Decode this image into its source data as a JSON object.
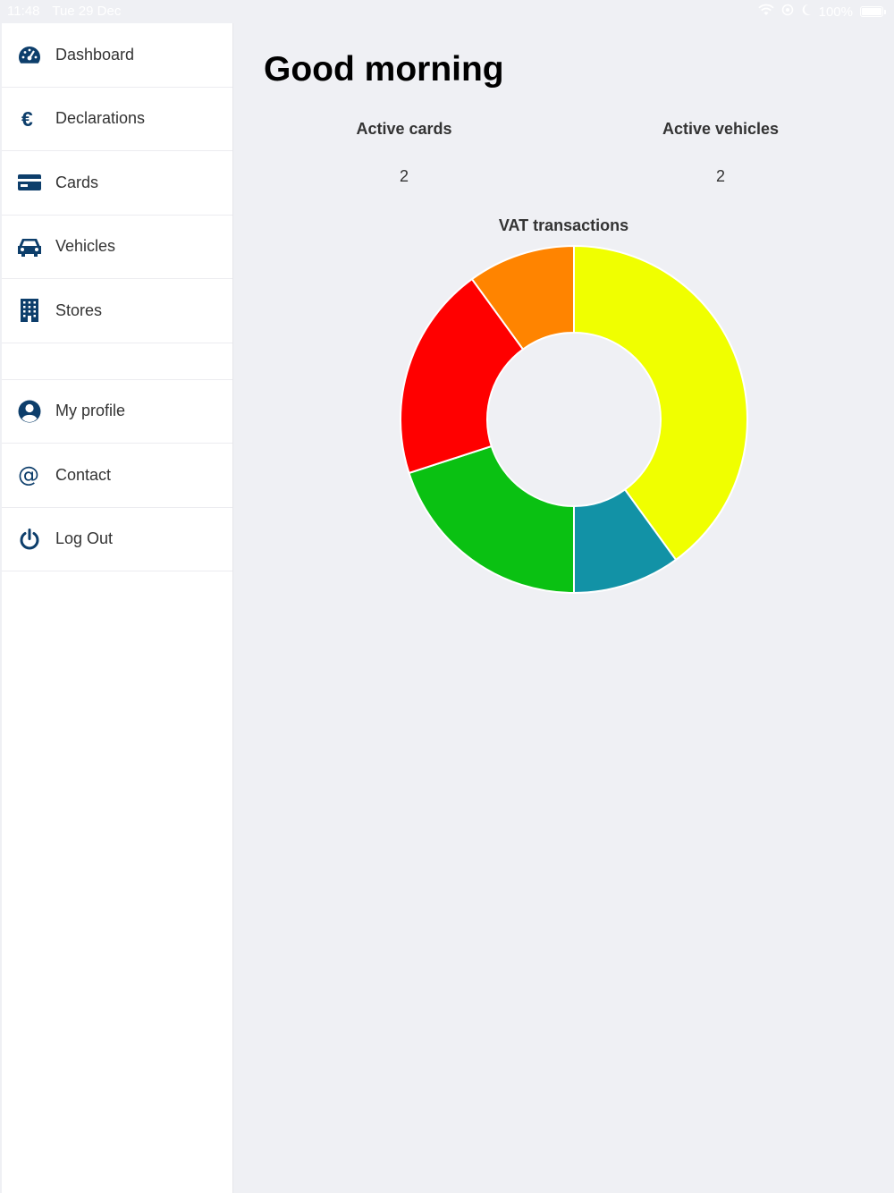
{
  "status_bar": {
    "time": "11:48",
    "date": "Tue 29 Dec",
    "battery": "100%",
    "icons": [
      "wifi-icon",
      "location-lock-icon",
      "moon-icon",
      "battery-icon"
    ]
  },
  "sidebar": {
    "items": [
      {
        "label": "Dashboard",
        "icon": "speedometer-icon"
      },
      {
        "label": "Declarations",
        "icon": "euro-icon"
      },
      {
        "label": "Cards",
        "icon": "credit-card-icon"
      },
      {
        "label": "Vehicles",
        "icon": "car-icon"
      },
      {
        "label": "Stores",
        "icon": "building-icon"
      }
    ],
    "secondary_items": [
      {
        "label": "My profile",
        "icon": "user-icon"
      },
      {
        "label": "Contact",
        "icon": "at-icon"
      },
      {
        "label": "Log Out",
        "icon": "power-icon"
      }
    ],
    "icon_color": "#0d3e6b"
  },
  "main": {
    "greeting": "Good morning",
    "stats": [
      {
        "title": "Active cards",
        "value": "2"
      },
      {
        "title": "Active vehicles",
        "value": "2"
      }
    ]
  },
  "chart_data": {
    "type": "pie",
    "variant": "doughnut",
    "title": "VAT transactions",
    "categories": [
      "",
      "",
      "",
      "",
      ""
    ],
    "values": [
      40,
      10,
      20,
      20,
      10
    ],
    "colors": [
      "#f0ff00",
      "#1292a6",
      "#0ac112",
      "#ff0000",
      "#ff8400"
    ],
    "legend": "none"
  }
}
